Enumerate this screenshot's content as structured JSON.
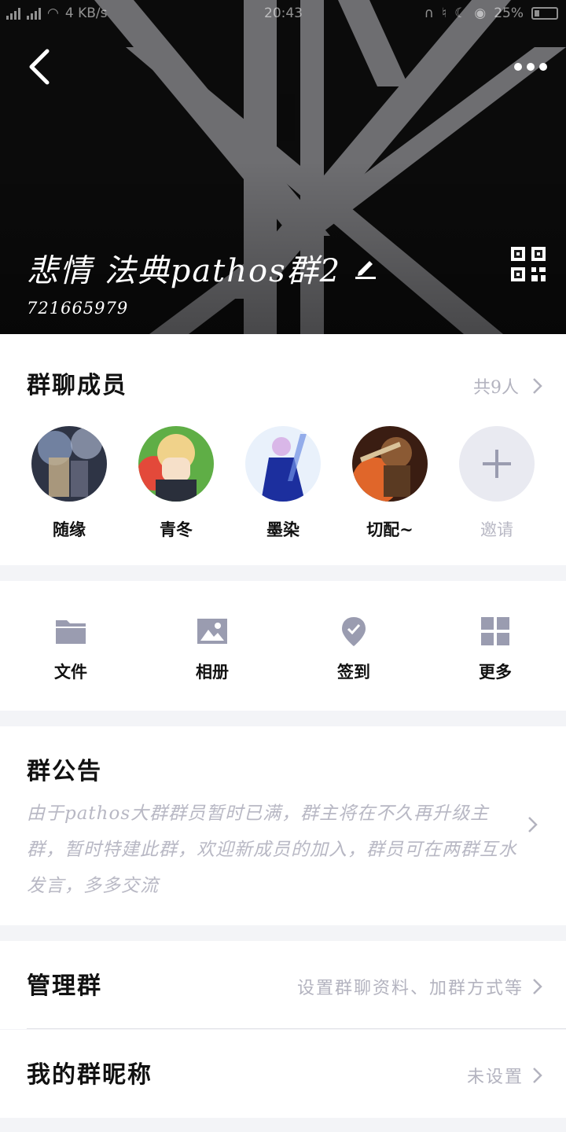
{
  "status_bar": {
    "network_speed": "4 KB/s",
    "time": "20:43",
    "battery": "25%"
  },
  "header": {
    "group_name": "悲情 法典pathos群2",
    "group_id": "721665979"
  },
  "members": {
    "title": "群聊成员",
    "count_label": "共9人",
    "list": [
      {
        "name": "随缘"
      },
      {
        "name": "青冬"
      },
      {
        "name": "墨染"
      },
      {
        "name": "切配~"
      }
    ],
    "invite_label": "邀请"
  },
  "tools": [
    {
      "label": "文件",
      "icon": "folder-icon"
    },
    {
      "label": "相册",
      "icon": "image-icon"
    },
    {
      "label": "签到",
      "icon": "checkin-icon"
    },
    {
      "label": "更多",
      "icon": "grid-icon"
    }
  ],
  "notice": {
    "title": "群公告",
    "text": "由于pathos大群群员暂时已满，群主将在不久再升级主群，暂时特建此群，欢迎新成员的加入，群员可在两群互水发言，多多交流"
  },
  "manage": {
    "title": "管理群",
    "value": "设置群聊资料、加群方式等"
  },
  "nickname": {
    "title": "我的群昵称",
    "value": "未设置"
  },
  "colors": {
    "accent_gray": "#b3b3bf",
    "icon_gray": "#9a9cb0",
    "page_bg": "#f3f4f7"
  }
}
